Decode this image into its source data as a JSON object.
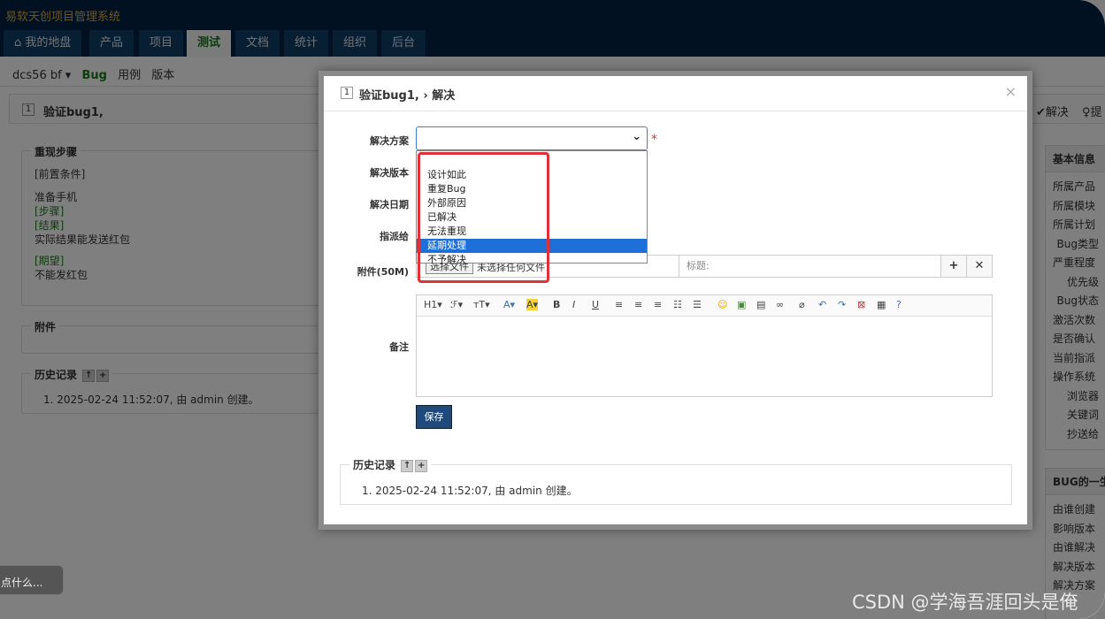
{
  "app": {
    "title": "易软天创项目管理系统"
  },
  "nav": {
    "tabs": [
      {
        "label": "我的地盘",
        "active": false
      },
      {
        "label": "产品",
        "active": false
      },
      {
        "label": "项目",
        "active": false
      },
      {
        "label": "测试",
        "active": true
      },
      {
        "label": "文档",
        "active": false
      },
      {
        "label": "统计",
        "active": false
      },
      {
        "label": "组织",
        "active": false
      },
      {
        "label": "后台",
        "active": false
      }
    ]
  },
  "subnav": {
    "product": "dcs56 bf ▾",
    "bug": "Bug",
    "case": "用例",
    "version": "版本"
  },
  "bug": {
    "id": "1",
    "title": "验证bug1,",
    "resolve_action": "解决",
    "hint_action": "提",
    "steps_legend": "重现步骤",
    "steps": {
      "pre": "[前置条件]",
      "prepare": "准备手机",
      "step": "[步骤]",
      "result": "[结果]",
      "actual": "实际结果能发送红包",
      "expect": "[期望]",
      "expect_text": "不能发红包"
    },
    "attachments_legend": "附件",
    "history_legend": "历史记录",
    "history_item": "1. 2025-02-24 11:52:07, 由 admin 创建。"
  },
  "side": {
    "basic": {
      "header": "基本信息",
      "rows": [
        "所属产品",
        "所属模块",
        "所属计划",
        "Bug类型",
        "严重程度",
        "优先级",
        "Bug状态",
        "激活次数",
        "是否确认",
        "当前指派",
        "操作系统",
        "浏览器",
        "关键词",
        "抄送给"
      ]
    },
    "life": {
      "header": "BUG的一生",
      "rows": [
        "由谁创建",
        "影响版本",
        "由谁解决",
        "解决版本",
        "解决方案"
      ]
    }
  },
  "toast": "点什么...",
  "modal": {
    "id": "1",
    "title": "验证bug1, › 解决",
    "close": "×",
    "labels": {
      "solution": "解决方案",
      "build": "解决版本",
      "date": "解决日期",
      "assign": "指派给",
      "files": "附件(50M)",
      "comment": "备注"
    },
    "required_mark": "*",
    "solution_options": [
      "",
      "设计如此",
      "重复Bug",
      "外部原因",
      "已解决",
      "无法重现",
      "延期处理",
      "不予解决"
    ],
    "selected_option": "延期处理",
    "file": {
      "button": "选择文件",
      "text": "未选择任何文件",
      "title_placeholder": "标题:",
      "add": "+",
      "remove": "✕"
    },
    "editor_toolbar": [
      "H1▾",
      "ℱ▾",
      "ᴛT▾",
      "A▾",
      "A▾",
      "B",
      "I",
      "U",
      "≡",
      "≡",
      "≡",
      "☷",
      "☰",
      "☺",
      "▣",
      "▤",
      "∞",
      "⌀",
      "↶",
      "↷",
      "⊠",
      "▦",
      "?"
    ],
    "save": "保存",
    "history_legend": "历史记录",
    "history_item": "1. 2025-02-24 11:52:07, 由 admin 创建。"
  },
  "watermark": "CSDN @学海吾涯回头是俺"
}
